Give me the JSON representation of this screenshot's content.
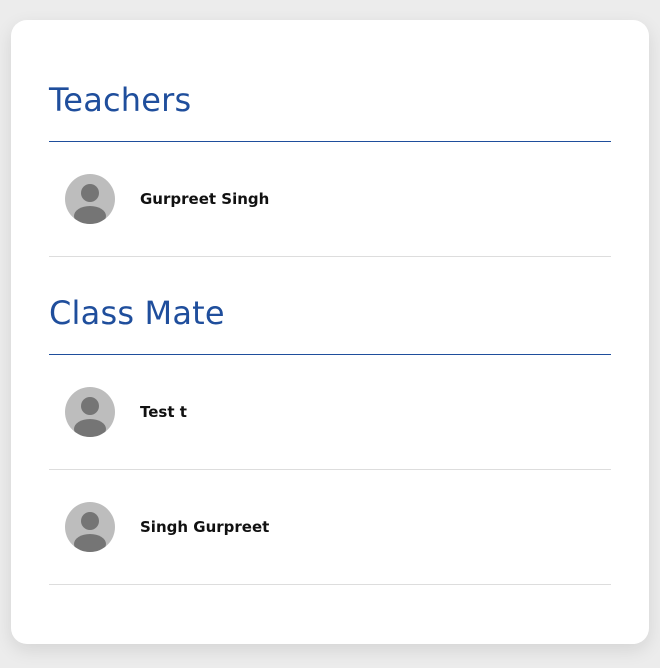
{
  "teachers": {
    "title": "Teachers",
    "members": [
      {
        "name": "Gurpreet Singh",
        "avatar_icon": "user-avatar-icon"
      }
    ]
  },
  "classmates": {
    "title": "Class Mate",
    "members": [
      {
        "name": "Test t",
        "avatar_icon": "user-avatar-icon"
      },
      {
        "name": "Singh Gurpreet",
        "avatar_icon": "user-avatar-icon"
      }
    ]
  },
  "colors": {
    "heading": "#1f4e9c",
    "avatar_bg": "#bdbdbd",
    "avatar_fg": "#757575",
    "page_bg": "#ececec",
    "card_bg": "#ffffff"
  }
}
